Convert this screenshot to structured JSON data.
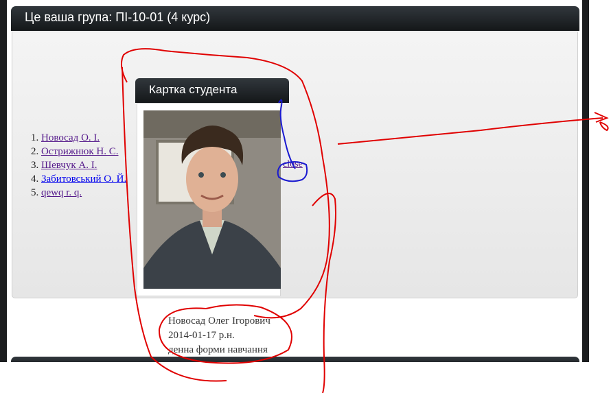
{
  "group_panel": {
    "title": "Це ваша група: ПІ-10-01 (4 курс)"
  },
  "students": [
    {
      "name": "Новосад О. І."
    },
    {
      "name": "Остриж­нюк Н. С."
    },
    {
      "name": "Шевчук А. І."
    },
    {
      "name": "Забитовський О. Й."
    },
    {
      "name": "qewq r. q."
    }
  ],
  "student_card": {
    "title": "Картка студента",
    "close_label": "close",
    "full_name": "Новосад Олег Ігорович",
    "birth": "2014-01-17 р.н.",
    "study_form": "денна форми навчання"
  },
  "colors": {
    "header_dark": "#1b1d1f",
    "link_visited": "#551a8b",
    "annotation_red": "#e00000",
    "annotation_blue": "#1a1ad0"
  }
}
